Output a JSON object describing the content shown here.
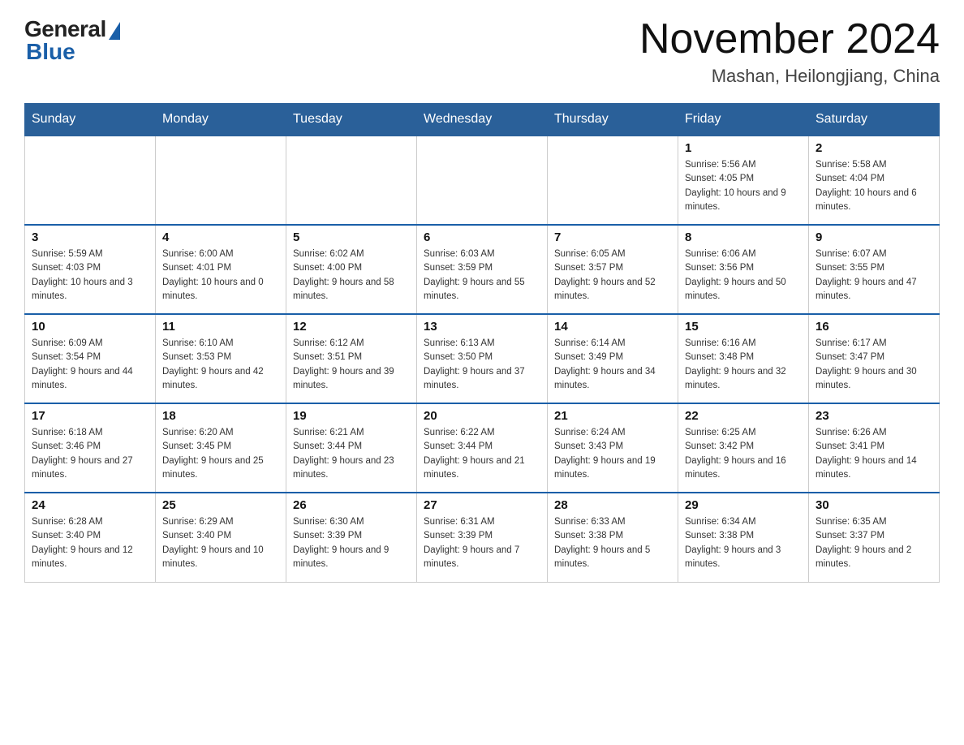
{
  "header": {
    "logo_general": "General",
    "logo_blue": "Blue",
    "month_title": "November 2024",
    "location": "Mashan, Heilongjiang, China"
  },
  "weekdays": [
    "Sunday",
    "Monday",
    "Tuesday",
    "Wednesday",
    "Thursday",
    "Friday",
    "Saturday"
  ],
  "weeks": [
    [
      {
        "num": "",
        "info": ""
      },
      {
        "num": "",
        "info": ""
      },
      {
        "num": "",
        "info": ""
      },
      {
        "num": "",
        "info": ""
      },
      {
        "num": "",
        "info": ""
      },
      {
        "num": "1",
        "info": "Sunrise: 5:56 AM\nSunset: 4:05 PM\nDaylight: 10 hours and 9 minutes."
      },
      {
        "num": "2",
        "info": "Sunrise: 5:58 AM\nSunset: 4:04 PM\nDaylight: 10 hours and 6 minutes."
      }
    ],
    [
      {
        "num": "3",
        "info": "Sunrise: 5:59 AM\nSunset: 4:03 PM\nDaylight: 10 hours and 3 minutes."
      },
      {
        "num": "4",
        "info": "Sunrise: 6:00 AM\nSunset: 4:01 PM\nDaylight: 10 hours and 0 minutes."
      },
      {
        "num": "5",
        "info": "Sunrise: 6:02 AM\nSunset: 4:00 PM\nDaylight: 9 hours and 58 minutes."
      },
      {
        "num": "6",
        "info": "Sunrise: 6:03 AM\nSunset: 3:59 PM\nDaylight: 9 hours and 55 minutes."
      },
      {
        "num": "7",
        "info": "Sunrise: 6:05 AM\nSunset: 3:57 PM\nDaylight: 9 hours and 52 minutes."
      },
      {
        "num": "8",
        "info": "Sunrise: 6:06 AM\nSunset: 3:56 PM\nDaylight: 9 hours and 50 minutes."
      },
      {
        "num": "9",
        "info": "Sunrise: 6:07 AM\nSunset: 3:55 PM\nDaylight: 9 hours and 47 minutes."
      }
    ],
    [
      {
        "num": "10",
        "info": "Sunrise: 6:09 AM\nSunset: 3:54 PM\nDaylight: 9 hours and 44 minutes."
      },
      {
        "num": "11",
        "info": "Sunrise: 6:10 AM\nSunset: 3:53 PM\nDaylight: 9 hours and 42 minutes."
      },
      {
        "num": "12",
        "info": "Sunrise: 6:12 AM\nSunset: 3:51 PM\nDaylight: 9 hours and 39 minutes."
      },
      {
        "num": "13",
        "info": "Sunrise: 6:13 AM\nSunset: 3:50 PM\nDaylight: 9 hours and 37 minutes."
      },
      {
        "num": "14",
        "info": "Sunrise: 6:14 AM\nSunset: 3:49 PM\nDaylight: 9 hours and 34 minutes."
      },
      {
        "num": "15",
        "info": "Sunrise: 6:16 AM\nSunset: 3:48 PM\nDaylight: 9 hours and 32 minutes."
      },
      {
        "num": "16",
        "info": "Sunrise: 6:17 AM\nSunset: 3:47 PM\nDaylight: 9 hours and 30 minutes."
      }
    ],
    [
      {
        "num": "17",
        "info": "Sunrise: 6:18 AM\nSunset: 3:46 PM\nDaylight: 9 hours and 27 minutes."
      },
      {
        "num": "18",
        "info": "Sunrise: 6:20 AM\nSunset: 3:45 PM\nDaylight: 9 hours and 25 minutes."
      },
      {
        "num": "19",
        "info": "Sunrise: 6:21 AM\nSunset: 3:44 PM\nDaylight: 9 hours and 23 minutes."
      },
      {
        "num": "20",
        "info": "Sunrise: 6:22 AM\nSunset: 3:44 PM\nDaylight: 9 hours and 21 minutes."
      },
      {
        "num": "21",
        "info": "Sunrise: 6:24 AM\nSunset: 3:43 PM\nDaylight: 9 hours and 19 minutes."
      },
      {
        "num": "22",
        "info": "Sunrise: 6:25 AM\nSunset: 3:42 PM\nDaylight: 9 hours and 16 minutes."
      },
      {
        "num": "23",
        "info": "Sunrise: 6:26 AM\nSunset: 3:41 PM\nDaylight: 9 hours and 14 minutes."
      }
    ],
    [
      {
        "num": "24",
        "info": "Sunrise: 6:28 AM\nSunset: 3:40 PM\nDaylight: 9 hours and 12 minutes."
      },
      {
        "num": "25",
        "info": "Sunrise: 6:29 AM\nSunset: 3:40 PM\nDaylight: 9 hours and 10 minutes."
      },
      {
        "num": "26",
        "info": "Sunrise: 6:30 AM\nSunset: 3:39 PM\nDaylight: 9 hours and 9 minutes."
      },
      {
        "num": "27",
        "info": "Sunrise: 6:31 AM\nSunset: 3:39 PM\nDaylight: 9 hours and 7 minutes."
      },
      {
        "num": "28",
        "info": "Sunrise: 6:33 AM\nSunset: 3:38 PM\nDaylight: 9 hours and 5 minutes."
      },
      {
        "num": "29",
        "info": "Sunrise: 6:34 AM\nSunset: 3:38 PM\nDaylight: 9 hours and 3 minutes."
      },
      {
        "num": "30",
        "info": "Sunrise: 6:35 AM\nSunset: 3:37 PM\nDaylight: 9 hours and 2 minutes."
      }
    ]
  ]
}
